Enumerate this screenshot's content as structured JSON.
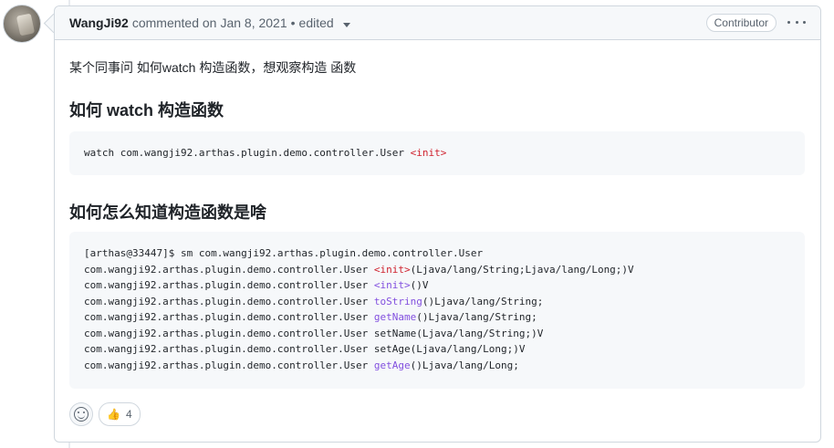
{
  "comment": {
    "author": "WangJi92",
    "action": "commented on",
    "date": "Jan 8, 2021",
    "separator": "•",
    "edited": "edited",
    "badge": "Contributor",
    "menu_icon": "kebab-horizontal-icon"
  },
  "body": {
    "intro": "某个同事问 如何watch 构造函数，想观察构造 函数",
    "heading1": "如何 watch 构造函数",
    "code1": [
      {
        "plain": "watch com.wangji92.arthas.plugin.demo.controller.User ",
        "tok": "<init>",
        "tok_color": "red",
        "rest": ""
      }
    ],
    "heading2": "如何怎么知道构造函数是啥",
    "code2": [
      {
        "plain": "[arthas@33447]$ sm com.wangji92.arthas.plugin.demo.controller.User",
        "tok": "",
        "tok_color": "",
        "rest": ""
      },
      {
        "plain": "com.wangji92.arthas.plugin.demo.controller.User ",
        "tok": "<init>",
        "tok_color": "red",
        "rest": "(Ljava/lang/String;Ljava/lang/Long;)V"
      },
      {
        "plain": "com.wangji92.arthas.plugin.demo.controller.User ",
        "tok": "<init>",
        "tok_color": "purple",
        "rest": "()V"
      },
      {
        "plain": "com.wangji92.arthas.plugin.demo.controller.User ",
        "tok": "toString",
        "tok_color": "purple",
        "rest": "()Ljava/lang/String;"
      },
      {
        "plain": "com.wangji92.arthas.plugin.demo.controller.User ",
        "tok": "getName",
        "tok_color": "purple",
        "rest": "()Ljava/lang/String;"
      },
      {
        "plain": "com.wangji92.arthas.plugin.demo.controller.User ",
        "tok": "",
        "tok_color": "",
        "rest": "setName(Ljava/lang/String;)V"
      },
      {
        "plain": "com.wangji92.arthas.plugin.demo.controller.User ",
        "tok": "",
        "tok_color": "",
        "rest": "setAge(Ljava/lang/Long;)V"
      },
      {
        "plain": "com.wangji92.arthas.plugin.demo.controller.User ",
        "tok": "getAge",
        "tok_color": "purple",
        "rest": "()Ljava/lang/Long;"
      }
    ]
  },
  "reactions": {
    "add_icon": "smiley-icon",
    "thumbs_up_icon": "👍",
    "thumbs_up_count": "4"
  }
}
